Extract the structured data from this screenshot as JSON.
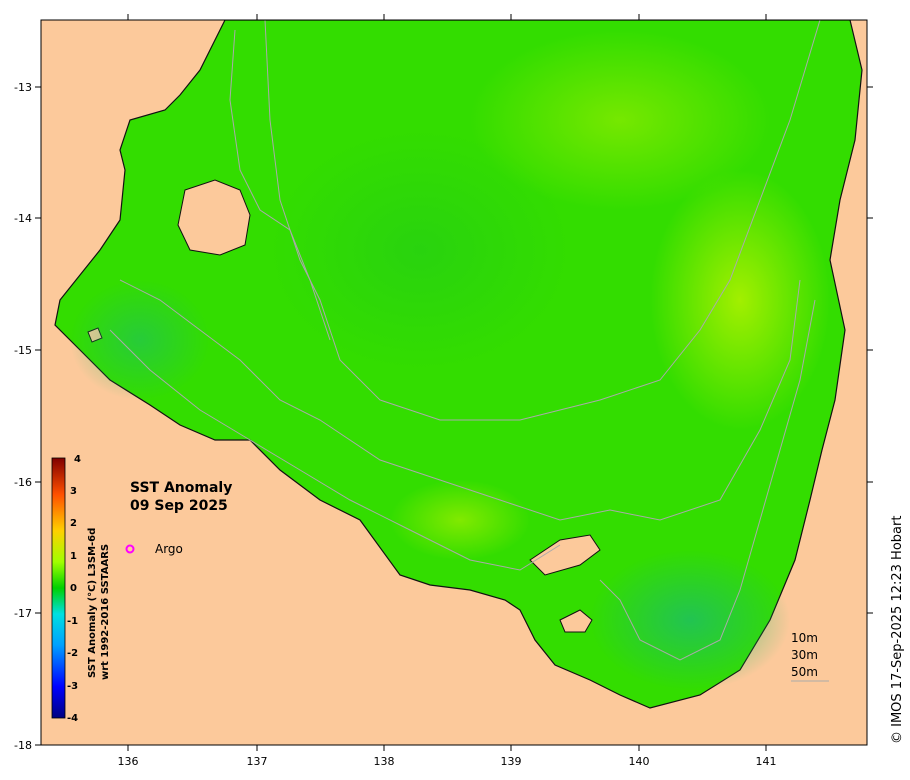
{
  "map": {
    "title_line1": "SST Anomaly",
    "title_line2": "09 Sep 2025",
    "credit": "© IMOS 17-Sep-2025 12:23 Hobart",
    "x_ticks": [
      "136",
      "137",
      "138",
      "139",
      "140",
      "141"
    ],
    "y_ticks": [
      "-13",
      "-14",
      "-15",
      "-16",
      "-17",
      "-18"
    ],
    "colorbar": {
      "label_line1": "SST Anomaly (°C) L3SM-6d",
      "label_line2": "wrt 1992-2016 SSTAARS",
      "ticks": [
        "4",
        "3",
        "2",
        "1",
        "0",
        "-1",
        "-2",
        "-3",
        "-4"
      ],
      "range": [
        -4,
        4
      ]
    },
    "legend": {
      "argo_label": "Argo",
      "argo_color": "#ff00ff"
    },
    "depth_labels": [
      "10m",
      "30m",
      "50m"
    ],
    "colors": {
      "land": "#fcc99b",
      "sea_main": "#33dd00",
      "sea_warm": "#9af000",
      "sea_cool": "#22c455",
      "isobath": "#aaaaaa"
    }
  }
}
